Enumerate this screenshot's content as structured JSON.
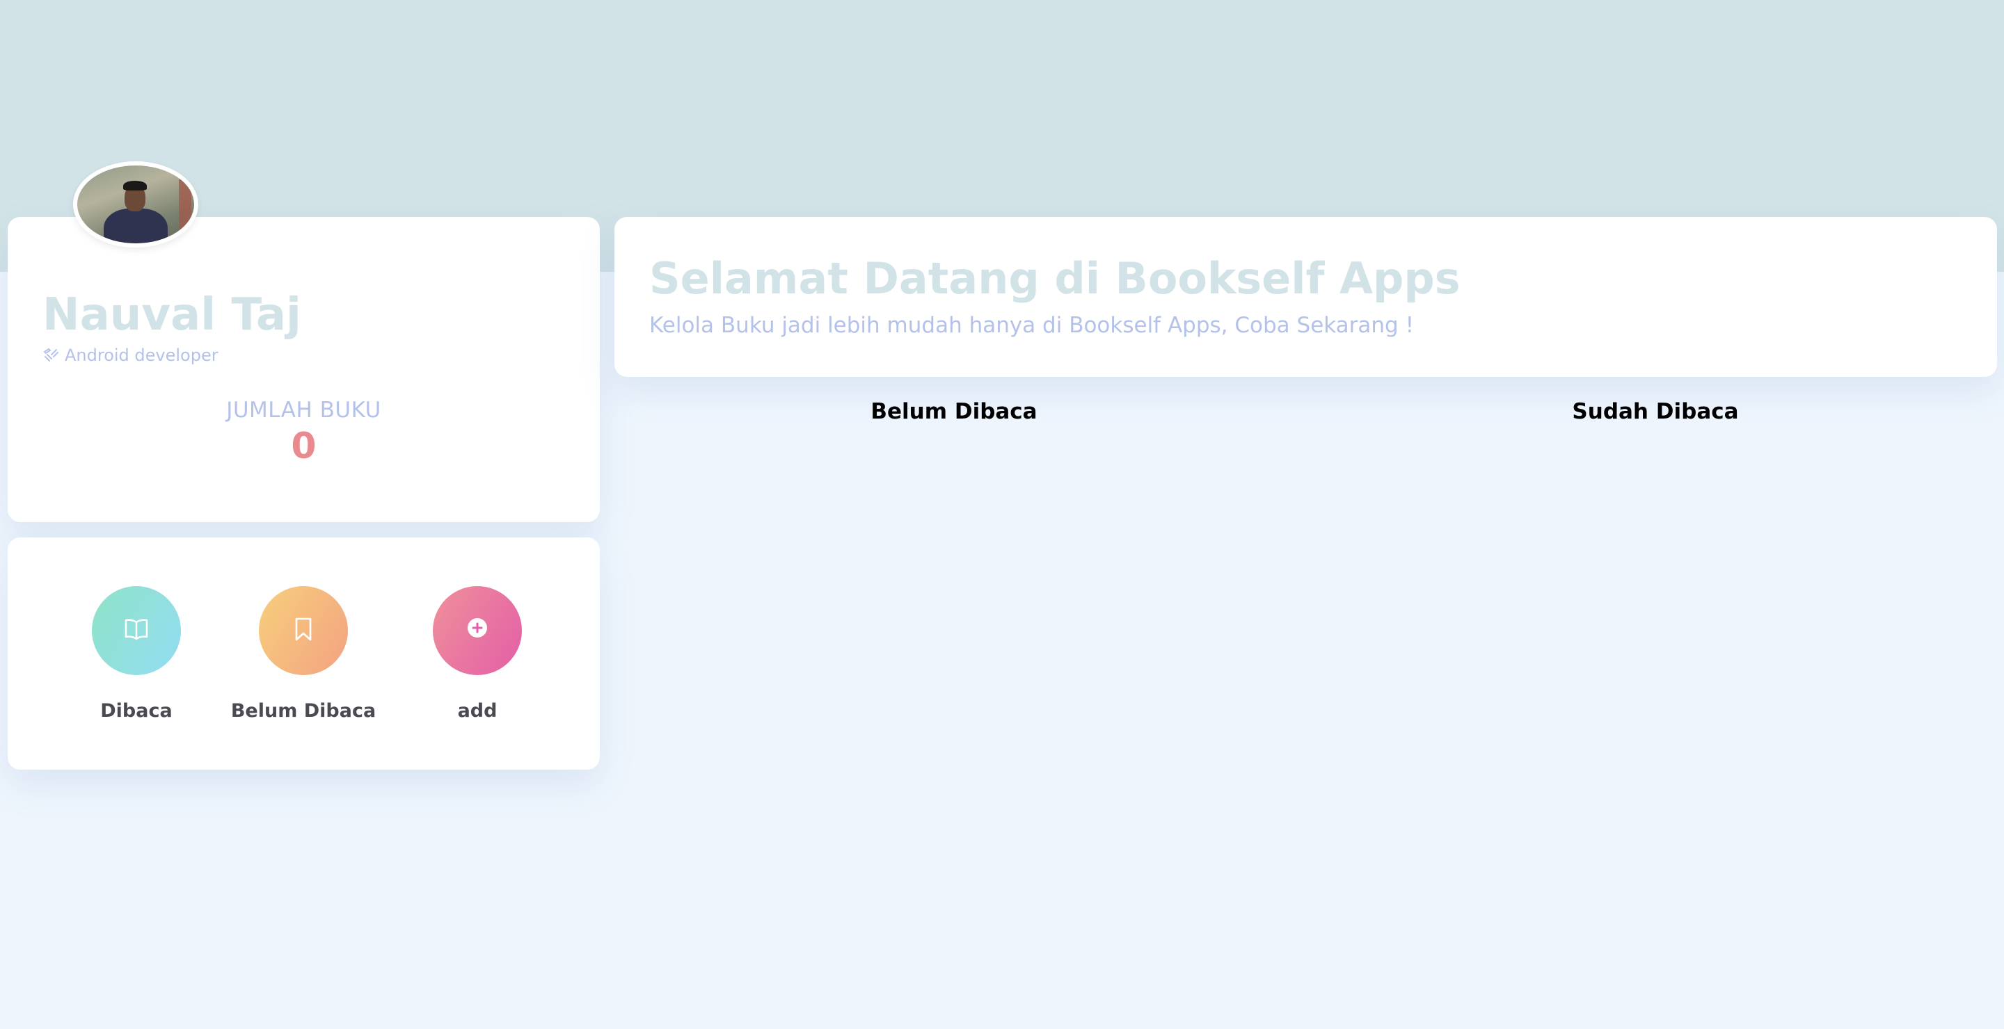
{
  "profile": {
    "name": "Nauval Taj",
    "role": "Android developer",
    "count_label": "JUMLAH BUKU",
    "count_value": "0"
  },
  "actions": [
    {
      "label": "Dibaca",
      "icon": "book-open-icon",
      "color": "#93dcf2"
    },
    {
      "label": "Belum Dibaca",
      "icon": "bookmark-icon",
      "color": "#f3a281"
    },
    {
      "label": "add",
      "icon": "plus-circle-icon",
      "color": "#e35ea6"
    }
  ],
  "welcome": {
    "title": "Selamat Datang di Bookself Apps",
    "subtitle": "Kelola Buku jadi lebih mudah hanya di Bookself Apps, Coba Sekarang !"
  },
  "shelves": {
    "unread_heading": "Belum Dibaca",
    "read_heading": "Sudah Dibaca"
  },
  "colors": {
    "header_band": "#d2e3e7",
    "page_background": "#eef5fd",
    "accent_text": "#b4c2ea",
    "count_color": "#ea8a8f"
  }
}
